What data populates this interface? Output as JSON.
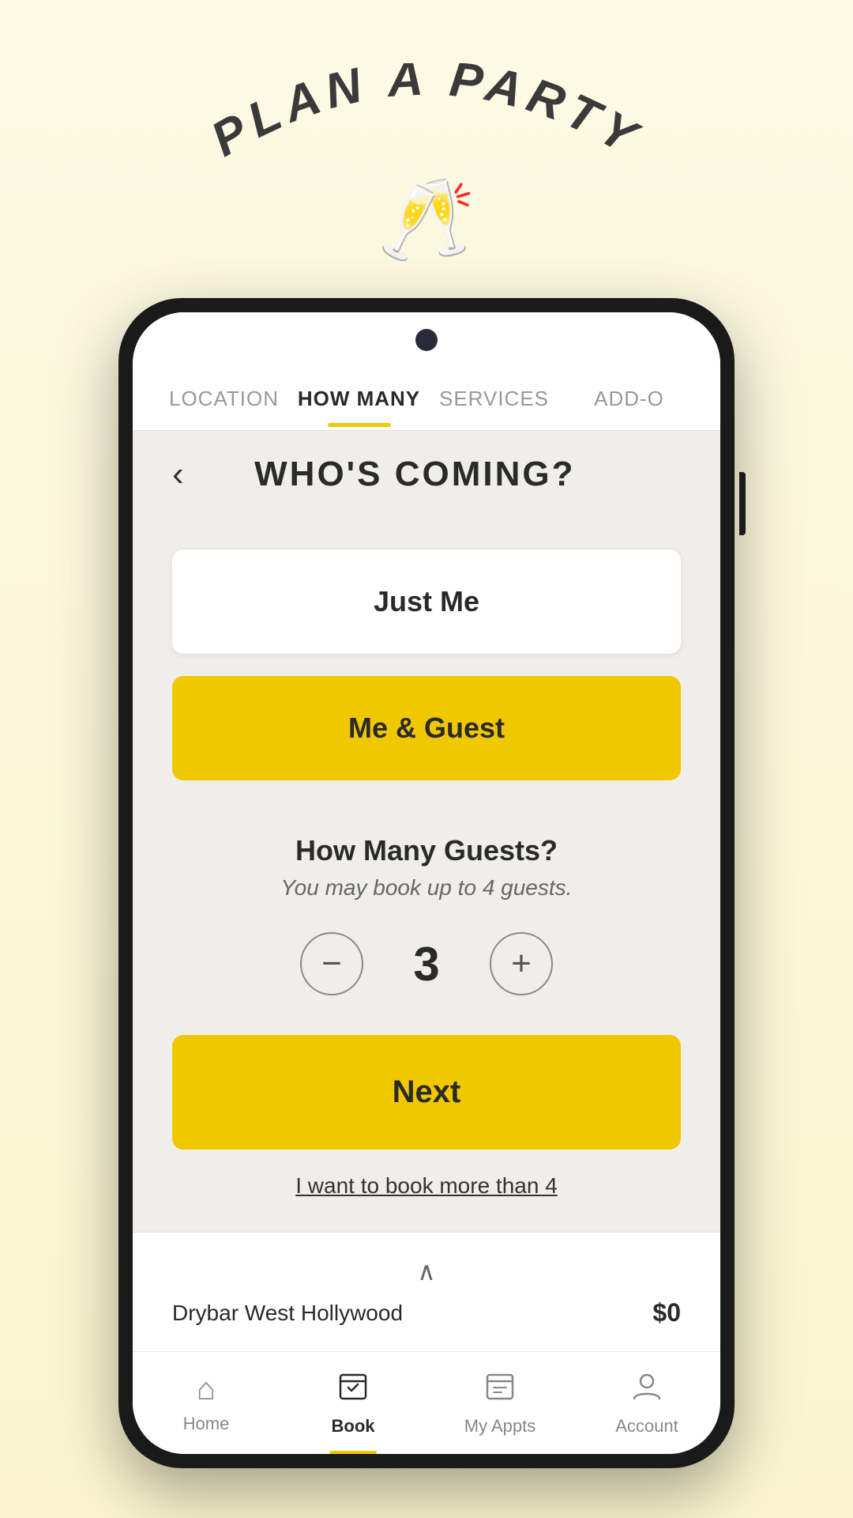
{
  "app": {
    "title": "PLAN A PARTY",
    "champagne_icon": "🥂"
  },
  "tabs": {
    "items": [
      {
        "id": "location",
        "label": "LOCATION",
        "active": false
      },
      {
        "id": "how-many",
        "label": "HOW MANY",
        "active": true
      },
      {
        "id": "services",
        "label": "SERVICES",
        "active": false
      },
      {
        "id": "add-ons",
        "label": "ADD-O",
        "active": false
      }
    ]
  },
  "page": {
    "title": "WHO'S COMING?",
    "back_label": "‹"
  },
  "options": {
    "just_me": "Just Me",
    "me_and_guest": "Me & Guest"
  },
  "guests": {
    "section_title": "How Many Guests?",
    "subtitle": "You may book up to 4 guests.",
    "count": "3",
    "decrement_icon": "−",
    "increment_icon": "+"
  },
  "next_button": {
    "label": "Next"
  },
  "book_more": {
    "label": "I want to book more than 4"
  },
  "bottom_bar": {
    "chevron": "∧",
    "location": "Drybar West Hollywood",
    "price": "$0"
  },
  "bottom_nav": {
    "items": [
      {
        "id": "home",
        "label": "Home",
        "icon": "⌂",
        "active": false
      },
      {
        "id": "book",
        "label": "Book",
        "icon": "📅",
        "active": true
      },
      {
        "id": "appointments",
        "label": "My Appts",
        "icon": "📋",
        "active": false
      },
      {
        "id": "account",
        "label": "Account",
        "icon": "👤",
        "active": false
      }
    ]
  }
}
